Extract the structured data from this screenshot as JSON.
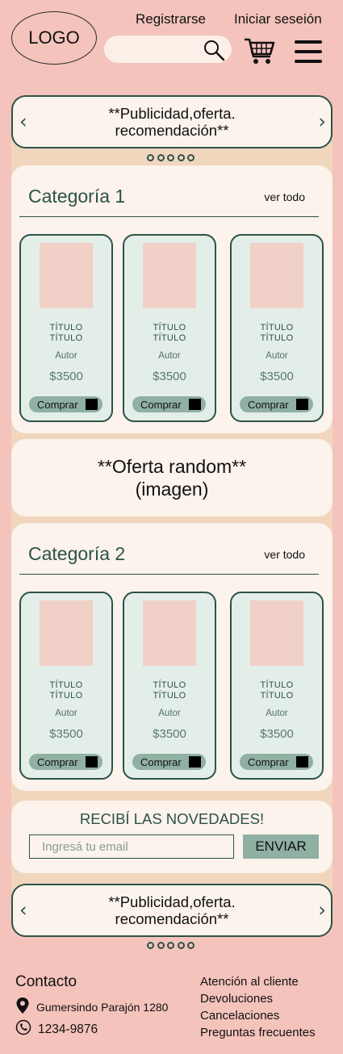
{
  "header": {
    "logo": "LOGO",
    "register": "Registrarse",
    "login": "Iniciar seseión"
  },
  "top_banner": {
    "prev": "‹",
    "text": "**Publicidad,oferta. recomendación**",
    "next": "›"
  },
  "categories": [
    {
      "title": "Categoría 1",
      "see_all": "ver todo",
      "products": [
        {
          "title1": "TÍTULO",
          "title2": "TÍTULO",
          "author": "Autor",
          "price": "$3500",
          "buy": "Comprar"
        },
        {
          "title1": "TÍTULO",
          "title2": "TÍTULO",
          "author": "Autor",
          "price": "$3500",
          "buy": "Comprar"
        },
        {
          "title1": "TÍTULO",
          "title2": "TÍTULO",
          "author": "Autor",
          "price": "$3500",
          "buy": "Comprar"
        }
      ]
    },
    {
      "title": "Categoría 2",
      "see_all": "ver todo",
      "products": [
        {
          "title1": "TÍTULO",
          "title2": "TÍTULO",
          "author": "Autor",
          "price": "$3500",
          "buy": "Comprar"
        },
        {
          "title1": "TÍTULO",
          "title2": "TÍTULO",
          "author": "Autor",
          "price": "$3500",
          "buy": "Comprar"
        },
        {
          "title1": "TÍTULO",
          "title2": "TÍTULO",
          "author": "Autor",
          "price": "$3500",
          "buy": "Comprar"
        }
      ]
    }
  ],
  "offer": {
    "text": "**Oferta random** (imagen)"
  },
  "newsletter": {
    "title": "RECIBÍ LAS NOVEDADES!",
    "placeholder": "Ingresá tu email",
    "button": "ENVIAR"
  },
  "bottom_banner": {
    "prev": "‹",
    "text": "**Publicidad,oferta. recomendación**",
    "next": "›"
  },
  "footer": {
    "contact_title": "Contacto",
    "address": "Gumersindo Parajón 1280",
    "phone": "1234-9876",
    "links": [
      "Atención al cliente",
      "Devoluciones",
      "Cancelaciones",
      "Preguntas frecuentes"
    ]
  },
  "colors": {
    "background": "#f4c3bb",
    "panel": "#f1d6be",
    "card": "#fbf3ec",
    "accent": "#2c5247",
    "button": "#8fb0a2"
  }
}
